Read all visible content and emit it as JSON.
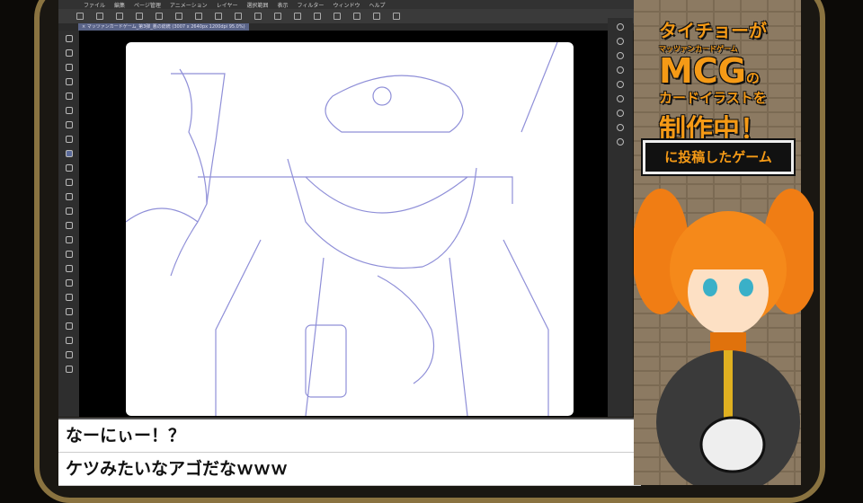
{
  "menu": [
    "ファイル",
    "編集",
    "ページ管理",
    "アニメーション",
    "レイヤー",
    "選択範囲",
    "表示",
    "フィルター",
    "ウィンドウ",
    "ヘルプ"
  ],
  "document_tab": "× マッツァンカードゲーム_第3弾_悪の総統 (3007 x 2640px 1200dpi 95.0%)",
  "chat": [
    "なーにぃー！？",
    "ケツみたいなアゴだなｗｗｗ"
  ],
  "overlay": {
    "line1": "タイチョーが",
    "ruby": "マッツァンカードゲーム",
    "line2": "MCG",
    "line2b": "の",
    "line3": "カードイラストを",
    "line4": "制作中！",
    "badge": "に投稿したゲーム"
  },
  "colors": {
    "accent": "#f59a16",
    "sketch": "#8f8fd8"
  }
}
